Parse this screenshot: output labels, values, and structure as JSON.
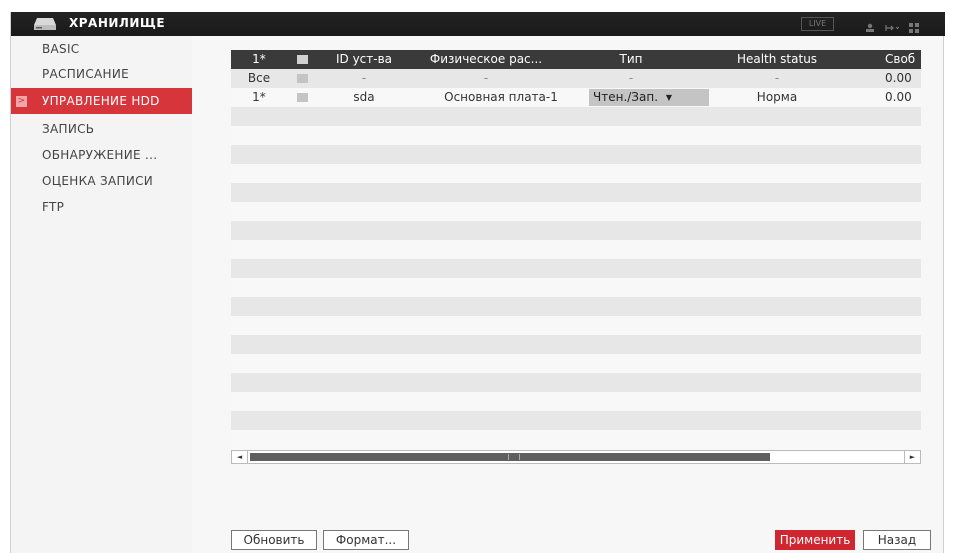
{
  "app": {
    "title": "ХРАНИЛИЩЕ",
    "live_label": "LIVE"
  },
  "sidebar": {
    "items": [
      {
        "label": "BASIC",
        "active": false
      },
      {
        "label": "РАСПИСАНИЕ",
        "active": false
      },
      {
        "label": "УПРАВЛЕНИЕ HDD",
        "active": true
      },
      {
        "label": "ЗАПИСЬ",
        "active": false
      },
      {
        "label": "ОБНАРУЖЕНИЕ ...",
        "active": false
      },
      {
        "label": "ОЦЕНКА ЗАПИСИ",
        "active": false
      },
      {
        "label": "FTP",
        "active": false
      }
    ],
    "active_marker": ">"
  },
  "table": {
    "headers": {
      "num": "1*",
      "device_id": "ID уст-ва",
      "physical": "Физическое рас...",
      "type": "Тип",
      "health": "Health status",
      "free": "Своб"
    },
    "all_row": {
      "num": "Все",
      "device_id": "-",
      "physical": "-",
      "type": "-",
      "health": "-",
      "free": "0.00"
    },
    "disks": [
      {
        "num": "1*",
        "device_id": "sda",
        "physical": "Основная плата-1",
        "type": "Чтен./Зап.",
        "health": "Норма",
        "free": "0.00"
      }
    ]
  },
  "dropdown_arrow": "▼",
  "scrollbar": {
    "left_arrow": "◄",
    "right_arrow": "►"
  },
  "buttons": {
    "refresh": "Обновить",
    "format": "Формат...",
    "apply": "Применить",
    "back": "Назад"
  },
  "colors": {
    "accent": "#d6363b",
    "header_bg": "#3a3a3a",
    "topbar_bg": "#1f1f1f"
  }
}
